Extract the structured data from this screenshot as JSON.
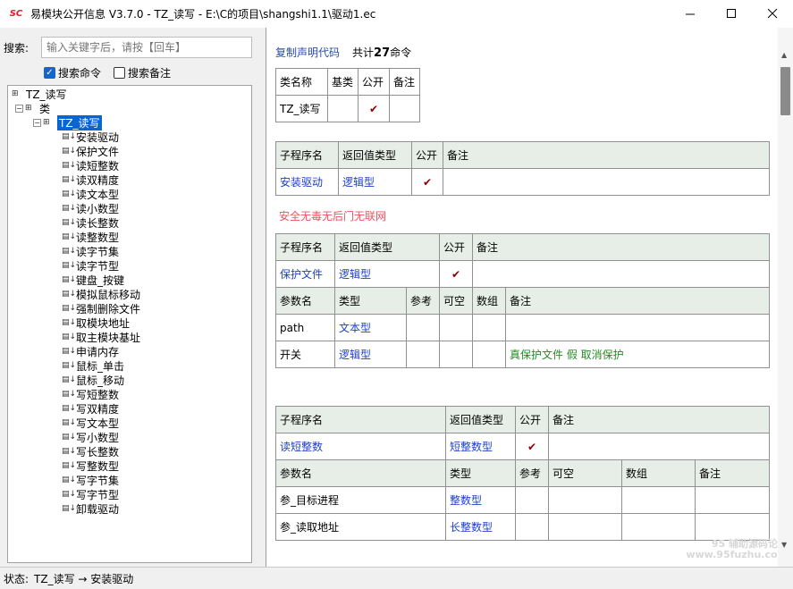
{
  "window": {
    "title": "易模块公开信息 V3.7.0 - TZ_读写 - E:\\C的项目\\shangshi1.1\\驱动1.ec",
    "app_icon": "SC"
  },
  "search": {
    "label": "搜索:",
    "placeholder": "输入关键字后，请按【回车】",
    "opt_commands": "搜索命令",
    "opt_commands_checked": true,
    "opt_notes": "搜索备注",
    "opt_notes_checked": false
  },
  "tree": {
    "root": "TZ_读写",
    "class_group": "类",
    "class_node": "TZ_读写",
    "items": [
      "安装驱动",
      "保护文件",
      "读短整数",
      "读双精度",
      "读文本型",
      "读小数型",
      "读长整数",
      "读整数型",
      "读字节集",
      "读字节型",
      "键盘_按键",
      "模拟鼠标移动",
      "强制删除文件",
      "取模块地址",
      "取主模块基址",
      "申请内存",
      "鼠标_单击",
      "鼠标_移动",
      "写短整数",
      "写双精度",
      "写文本型",
      "写小数型",
      "写长整数",
      "写整数型",
      "写字节集",
      "写字节型",
      "卸载驱动"
    ]
  },
  "content": {
    "copy_link": "复制声明代码",
    "count_prefix": "共计",
    "count_num": "27",
    "count_suffix": "命令",
    "class_table": {
      "headers": [
        "类名称",
        "基类",
        "公开",
        "备注"
      ],
      "row": {
        "name": "TZ_读写",
        "base": "",
        "public": "✔",
        "note": ""
      }
    },
    "sub1": {
      "headers": [
        "子程序名",
        "返回值类型",
        "公开",
        "备注"
      ],
      "name": "安装驱动",
      "ret": "逻辑型",
      "public": "✔",
      "note": ""
    },
    "warning": "安全无毒无后门无联网",
    "sub2": {
      "headers": [
        "子程序名",
        "返回值类型",
        "公开",
        "备注"
      ],
      "name": "保护文件",
      "ret": "逻辑型",
      "public": "✔",
      "note": "",
      "param_headers": [
        "参数名",
        "类型",
        "参考",
        "可空",
        "数组",
        "备注"
      ],
      "params": [
        {
          "name": "path",
          "type": "文本型",
          "note": ""
        },
        {
          "name": "开关",
          "type": "逻辑型",
          "note": "真保护文件 假 取消保护"
        }
      ]
    },
    "sub3": {
      "headers": [
        "子程序名",
        "返回值类型",
        "公开",
        "备注"
      ],
      "name": "读短整数",
      "ret": "短整数型",
      "public": "✔",
      "note": "",
      "param_headers": [
        "参数名",
        "类型",
        "参考",
        "可空",
        "数组",
        "备注"
      ],
      "params": [
        {
          "name": "参_目标进程",
          "type": "整数型"
        },
        {
          "name": "参_读取地址",
          "type": "长整数型"
        }
      ]
    }
  },
  "status": {
    "label": "状态:",
    "value": "TZ_读写 → 安装驱动"
  },
  "watermark": {
    "line1": "95 辅助源码论坛",
    "line2": "www.95fuzhu.com"
  }
}
